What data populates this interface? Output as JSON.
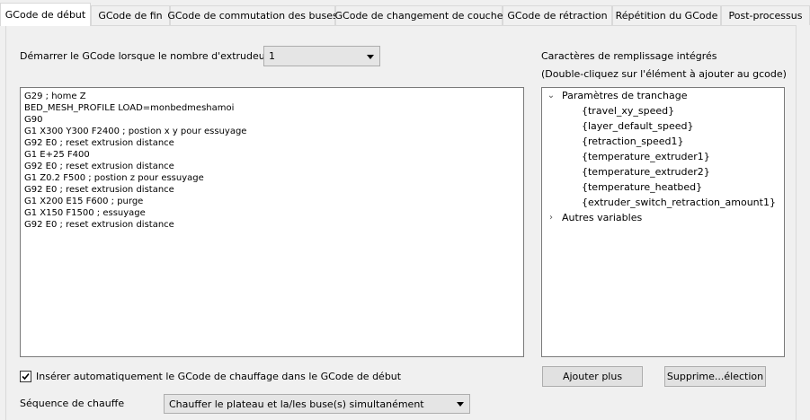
{
  "tabs": [
    {
      "label": "GCode de début"
    },
    {
      "label": "GCode de fin"
    },
    {
      "label": "GCode de commutation des buses"
    },
    {
      "label": "GCode de changement de couche"
    },
    {
      "label": "GCode de rétraction"
    },
    {
      "label": "Répétition du GCode"
    },
    {
      "label": "Post-processus"
    }
  ],
  "extruder_start": {
    "label": "Démarrer le GCode lorsque le nombre d'extrudeur est",
    "value": "1"
  },
  "gcode_lines": [
    "G29 ; home Z",
    "BED_MESH_PROFILE LOAD=monbedmeshamoi",
    "G90",
    "G1 X300 Y300 F2400 ; postion x y pour essuyage",
    "G92 E0 ; reset extrusion distance",
    "G1 E+25 F400",
    "G92 E0 ; reset extrusion distance",
    "G1 Z0.2 F500 ; postion z pour essuyage",
    "G92 E0 ; reset extrusion distance",
    "G1 X200 E15 F600 ; purge",
    "G1 X150 F1500 ; essuyage",
    "G92 E0 ; reset extrusion distance"
  ],
  "placeholders": {
    "title": "Caractères de remplissage intégrés",
    "hint": "(Double-cliquez sur l'élément à ajouter au gcode)",
    "group_expanded": "Paramètres de tranchage",
    "items": [
      "{travel_xy_speed}",
      "{layer_default_speed}",
      "{retraction_speed1}",
      "{temperature_extruder1}",
      "{temperature_extruder2}",
      "{temperature_heatbed}",
      "{extruder_switch_retraction_amount1}"
    ],
    "group_collapsed": "Autres variables"
  },
  "buttons": {
    "add_more": "Ajouter plus",
    "delete_selection": "Supprime...élection"
  },
  "auto_heat": {
    "label": "Insérer automatiquement le GCode de chauffage dans le GCode de début",
    "checked": true
  },
  "heat_sequence": {
    "label": "Séquence de chauffe",
    "value": "Chauffer le plateau et la/les buse(s) simultanément"
  }
}
